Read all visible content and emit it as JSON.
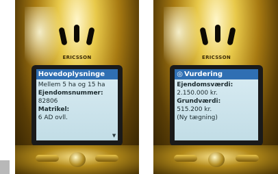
{
  "phones": [
    {
      "brand": "ERICSSON",
      "screen": {
        "title": "Hovedoplysninge",
        "lines": [
          {
            "kind": "value",
            "text": "Mellem 5 ha og 15 ha"
          },
          {
            "kind": "label",
            "text": "Ejendomsnummer:"
          },
          {
            "kind": "value",
            "text": "82806"
          },
          {
            "kind": "label",
            "text": "Matrikel:"
          },
          {
            "kind": "value",
            "text": "6 AD ovll."
          }
        ]
      }
    },
    {
      "brand": "ERICSSON",
      "screen": {
        "title": "Vurdering",
        "title_icon": "◎",
        "lines": [
          {
            "kind": "label",
            "text": "Ejendomsværdi:"
          },
          {
            "kind": "value",
            "text": "2.150.000 kr."
          },
          {
            "kind": "label",
            "text": "Grundværdi:"
          },
          {
            "kind": "value",
            "text": "515.200 kr."
          },
          {
            "kind": "value",
            "text": "(Ny tægning)"
          }
        ]
      }
    }
  ],
  "colors": {
    "title_bar": "#2f6fb3",
    "screen_bg": "#cfe5ec",
    "gold": "#c79d22"
  }
}
